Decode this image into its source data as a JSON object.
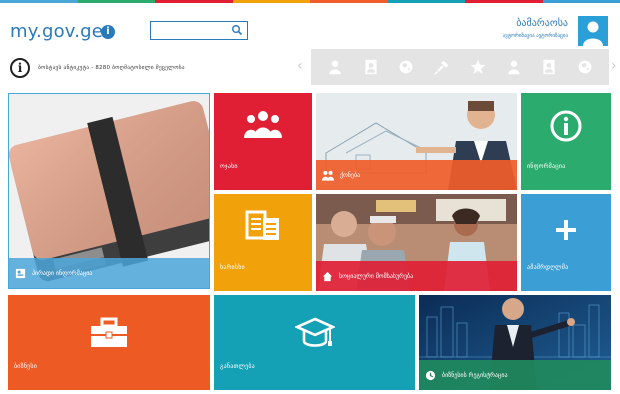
{
  "header": {
    "logo_text": "my.gov.ge",
    "logo_badge": "i",
    "search": {
      "placeholder": "",
      "icon": "search-icon"
    },
    "user": {
      "name": "ბამარაოსა",
      "subtitle": "ავტორიზაცია ავტორიზაცია"
    },
    "info_text": "ბოსტავს ანტიკუტა - 8280 ბოღმატოსილი მეცელოსა"
  },
  "toolbar": {
    "icons": [
      "person-icon",
      "portrait-icon",
      "globe-icon",
      "plug-icon",
      "star-icon",
      "person-icon",
      "portrait-icon",
      "globe-icon"
    ]
  },
  "tiles": {
    "personal": {
      "label": "პირადი ინფორმაცია",
      "color": "#4aa6d8"
    },
    "family": {
      "label": "ოჯახი",
      "color": "#e01f35"
    },
    "property": {
      "label": "ქონება",
      "color": "#f05c2a"
    },
    "information": {
      "label": "ინფორმაცია",
      "color": "#2bac6e"
    },
    "documents": {
      "label": "ხარისხი",
      "color": "#f1a20b"
    },
    "social": {
      "label": "სოციალური მომსახურება",
      "color": "#e01f35"
    },
    "services": {
      "label": "ამამრდღლმა",
      "color": "#3b9fd6"
    },
    "business": {
      "label": "ბიზნესი",
      "color": "#ee5a24"
    },
    "education": {
      "label": "განათლება",
      "color": "#14a0b5"
    },
    "business_registry": {
      "label": "ბიზნესის რეგისტრაცია",
      "color": "#1f8a5d"
    }
  },
  "colors": {
    "brand": "#2a7ab9",
    "topline": [
      "#4aa6d8",
      "#2bac6e",
      "#e01f35",
      "#f1a20b",
      "#f05c2a",
      "#14a0b5",
      "#e01f35",
      "#3b9fd6"
    ]
  }
}
